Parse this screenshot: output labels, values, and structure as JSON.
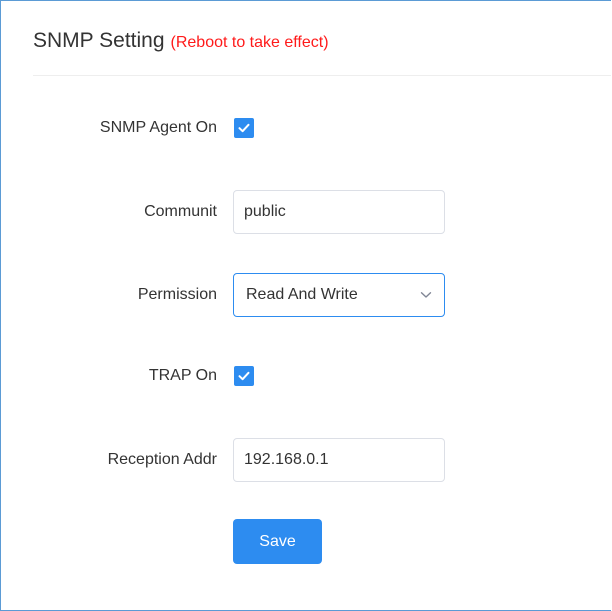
{
  "panel": {
    "title": "SNMP Setting",
    "note": "(Reboot to take effect)"
  },
  "form": {
    "snmp_agent": {
      "label": "SNMP Agent On",
      "checked": true
    },
    "community": {
      "label": "Communit",
      "value": "public"
    },
    "permission": {
      "label": "Permission",
      "selected": "Read And Write"
    },
    "trap": {
      "label": "TRAP On",
      "checked": true
    },
    "reception_addr": {
      "label": "Reception Addr",
      "value": "192.168.0.1"
    },
    "save_label": "Save"
  },
  "icons": {
    "checkbox_check": "check-icon",
    "select_arrow": "chevron-down-icon"
  },
  "colors": {
    "accent": "#2d8cf0",
    "note": "#ff1a1a",
    "panel_border": "#5b9bd5"
  }
}
